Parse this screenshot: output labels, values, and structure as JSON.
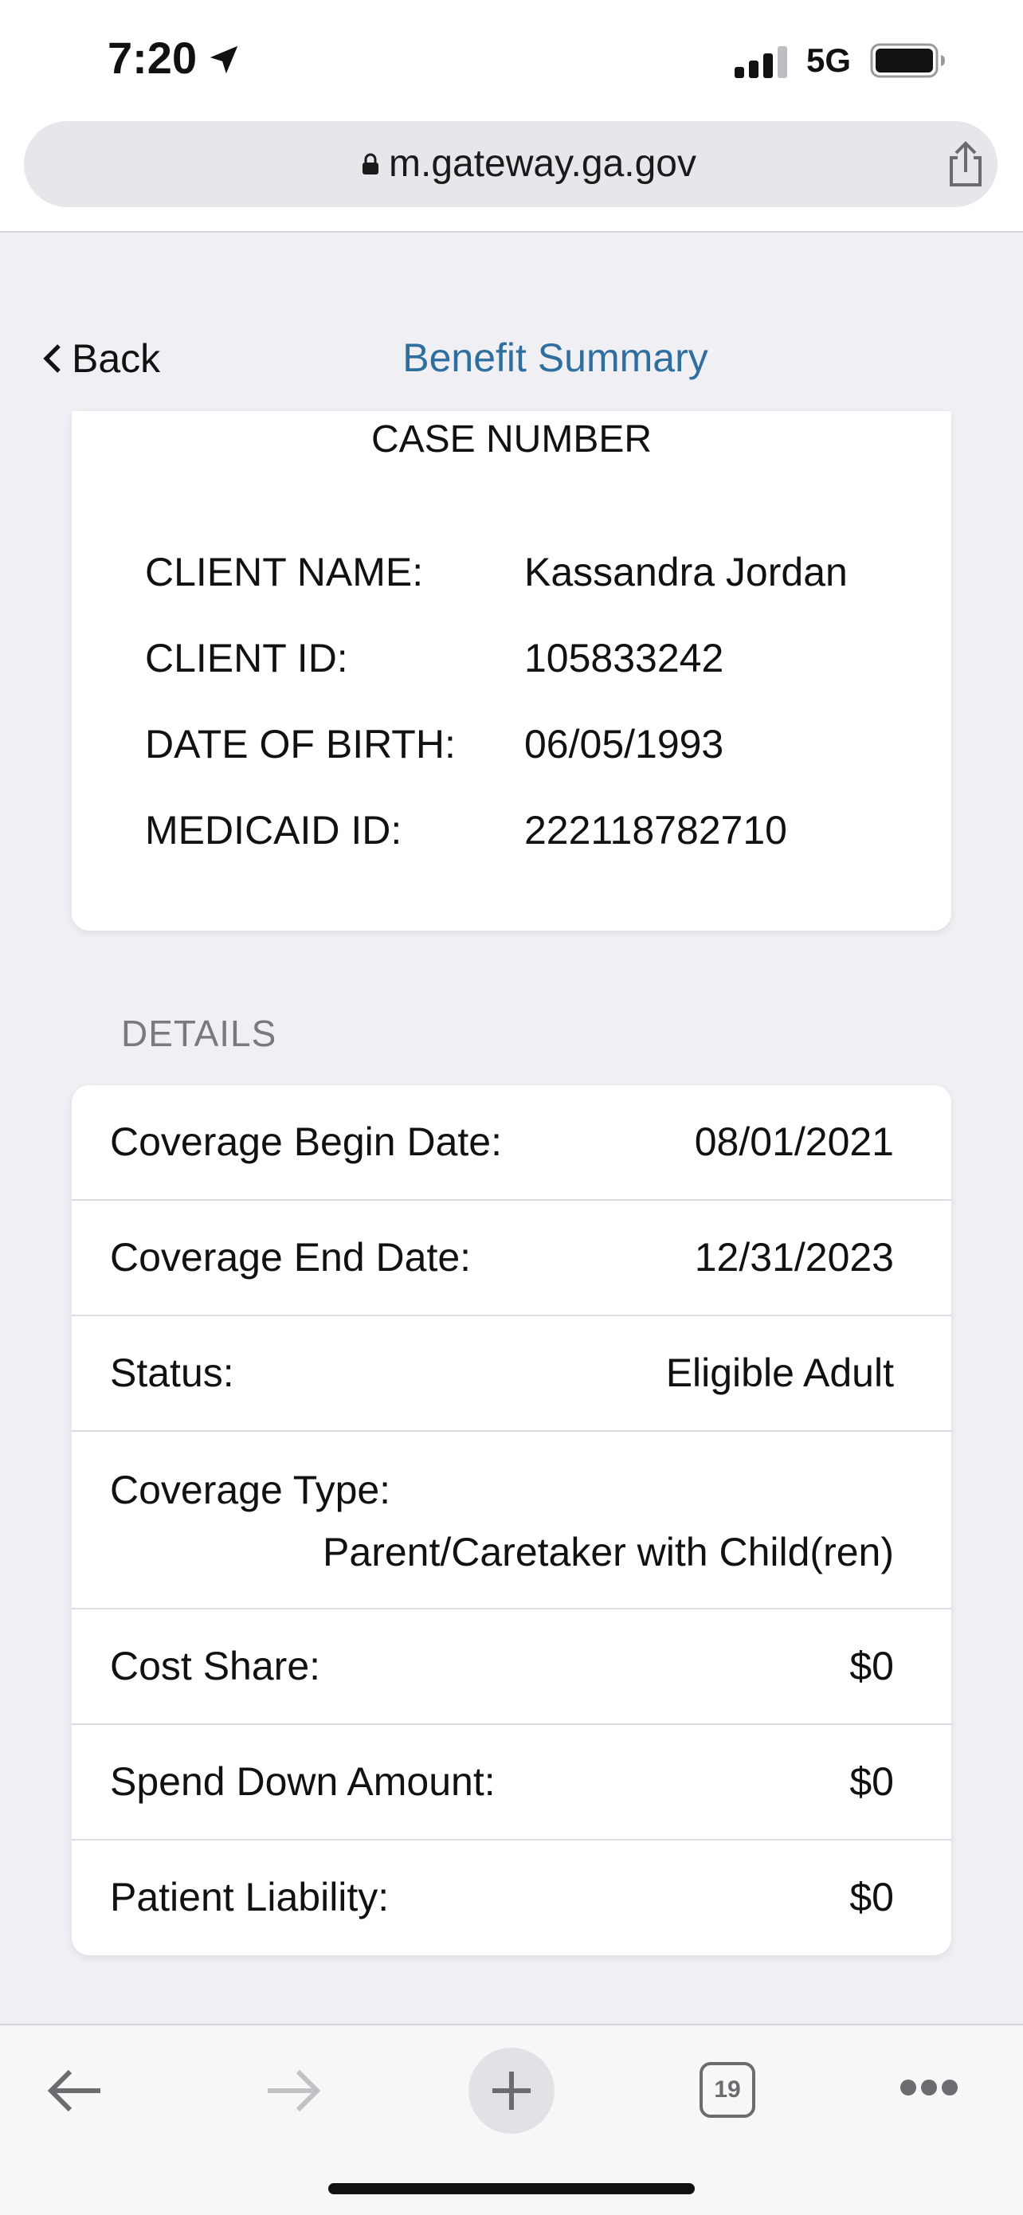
{
  "status_bar": {
    "time": "7:20",
    "network": "5G"
  },
  "browser": {
    "url": "m.gateway.ga.gov",
    "tabs_count": "19"
  },
  "nav": {
    "back_label": "Back",
    "title": "Benefit Summary"
  },
  "client": {
    "case_number_label": "CASE NUMBER",
    "fields": [
      {
        "label": "CLIENT NAME:",
        "value": "Kassandra Jordan"
      },
      {
        "label": "CLIENT ID:",
        "value": "105833242"
      },
      {
        "label": "DATE OF BIRTH:",
        "value": "06/05/1993"
      },
      {
        "label": "MEDICAID ID:",
        "value": "222118782710"
      }
    ]
  },
  "details": {
    "header": "DETAILS",
    "rows": [
      {
        "label": "Coverage Begin Date:",
        "value": "08/01/2021"
      },
      {
        "label": "Coverage End Date:",
        "value": "12/31/2023"
      },
      {
        "label": "Status:",
        "value": "Eligible Adult"
      },
      {
        "label": "Coverage Type:",
        "value": "Parent/Caretaker with Child(ren)"
      },
      {
        "label": "Cost Share:",
        "value": "$0"
      },
      {
        "label": "Spend Down Amount:",
        "value": "$0"
      },
      {
        "label": "Patient Liability:",
        "value": "$0"
      }
    ]
  },
  "colors": {
    "accent": "#2f6f9f",
    "background": "#efeff4"
  }
}
